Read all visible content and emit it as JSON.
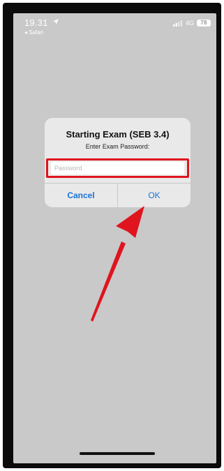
{
  "status_bar": {
    "time": "19.31",
    "back_label": "◂ Safari",
    "network": "4G",
    "battery": "78"
  },
  "dialog": {
    "title": "Starting Exam (SEB 3.4)",
    "message": "Enter Exam Password:",
    "password_placeholder": "Password",
    "password_value": "",
    "cancel_label": "Cancel",
    "ok_label": "OK"
  },
  "annotation": {
    "highlight_color": "#e0141e",
    "arrow_color": "#e0141e"
  },
  "icons": {
    "location": "location-arrow-icon",
    "signal": "cellular-signal-icon",
    "battery": "battery-icon"
  }
}
